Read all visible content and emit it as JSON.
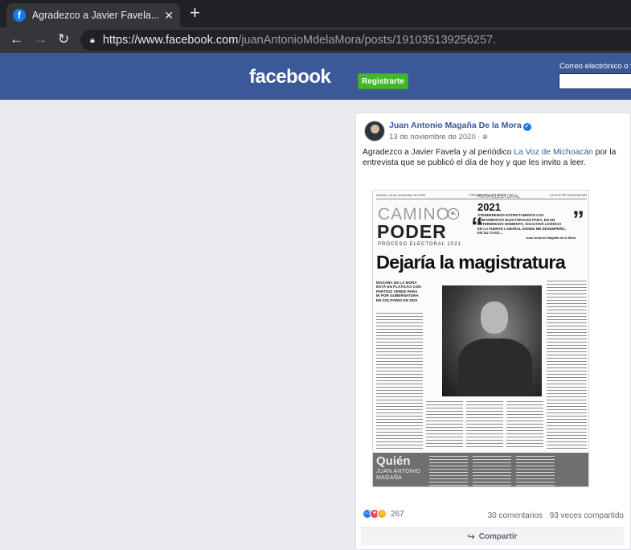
{
  "browser": {
    "tab_title": "Agradezco a Javier Favela... - ",
    "tab_close": "✕",
    "new_tab": "+",
    "back": "←",
    "forward": "→",
    "reload": "↻",
    "url_host": "https://www.facebook.com",
    "url_path": "/juanAntonioMdelaMora/posts/191035139256257."
  },
  "fb_header": {
    "logo": "facebook",
    "register_label": "Registrarte",
    "email_label": "Correo electrónico o te"
  },
  "post": {
    "author": "Juan Antonio Magaña De la Mora",
    "date": "13 de noviembre de 2020 ·",
    "text_before": "Agradezco a Javier Favela y al periódico ",
    "text_link": "La Voz de Michoacán",
    "text_after": " por la entrevista que se publicó el día de hoy y que les invito a leer."
  },
  "newspaper": {
    "top_left": "Viernes, 13 de noviembre de 2020",
    "top_mid": "PROCESO ELECTORAL",
    "top_right": "LA VOZ DE MICHOACÁN",
    "camino": "CAMINO",
    "al": "AL",
    "poder": "PODER",
    "proceso": "PROCESO ELECTORAL 2021",
    "ruta": "RUTA ELECTORAL",
    "year": "2021",
    "quote": "ATENDEREMOS ESTRICTAMENTE LOS LINEAMIENTOS ELECTORALES PARA, EN UN DETERMINADO MOMENTO, SOLICITAR LICENCIA EN LA FUENTE LABORAL DONDE ME DESEMPEÑO, EN SU CASO...",
    "signed": "Juan Antonio Magaña de la Mora",
    "headline": "Dejaría la magistratura",
    "kicker": "MAGAÑA DE LA MORA ESTÁ EN PLÁTICAS CON PARTIDO VERDE PARA IR POR GUBERNATURA EN SOLITARIO EN 2021",
    "quien": "Quién",
    "quien_name": "JUAN ANTONIO MAGAÑA"
  },
  "reactions": {
    "count": "267",
    "comments": "30 comentarios",
    "shares": "93 veces compartido",
    "share_label": "Compartir"
  }
}
